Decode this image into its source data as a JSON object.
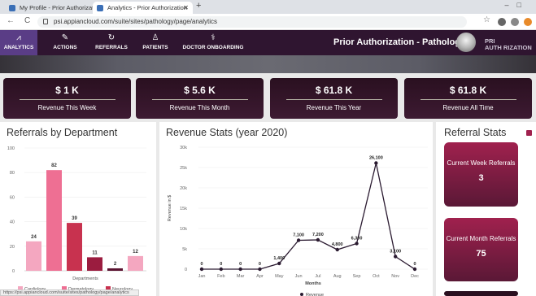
{
  "browser": {
    "tabs": [
      {
        "title": "My Profile - Prior Authorization"
      },
      {
        "title": "Analytics - Prior Authorization"
      }
    ],
    "url": "psi.appiancloud.com/suite/sites/pathology/page/analytics",
    "status_url": "https://psi.appiancloud.com/suite/sites/pathology/page/analytics"
  },
  "nav": {
    "items": [
      {
        "label": "ANALYTICS",
        "icon": "analytics-icon"
      },
      {
        "label": "ACTIONS",
        "icon": "actions-icon"
      },
      {
        "label": "REFERRALS",
        "icon": "referrals-icon"
      },
      {
        "label": "PATIENTS",
        "icon": "patients-icon"
      },
      {
        "label": "DOCTOR ONBOARDING",
        "icon": "doctor-icon"
      }
    ],
    "site_title": "Prior Authorization - Pathology",
    "logo_top": "PRI",
    "logo_bottom": "AUTH RIZATION"
  },
  "kpis": [
    {
      "value": "$ 1 K",
      "label": "Revenue This Week"
    },
    {
      "value": "$ 5.6 K",
      "label": "Revenue This Month"
    },
    {
      "value": "$ 61.8 K",
      "label": "Revenue This Year"
    },
    {
      "value": "$ 61.8 K",
      "label": "Revenue All Time"
    }
  ],
  "referrals": {
    "title": "Referrals by Department"
  },
  "revenue": {
    "title": "Revenue Stats (year 2020)"
  },
  "referral_stats": {
    "title": "Referral Stats",
    "cards": [
      {
        "label": "Current Week Referrals",
        "value": "3"
      },
      {
        "label": "Current Month Referrals",
        "value": "75"
      }
    ]
  },
  "chart_data": [
    {
      "type": "bar",
      "xlabel": "Departments",
      "ylim": [
        0,
        100
      ],
      "yticks": [
        0,
        20,
        40,
        60,
        80,
        100
      ],
      "values": [
        24,
        82,
        39,
        11,
        2,
        12
      ],
      "colors": [
        "#f4a7c0",
        "#ee6f93",
        "#c8324f",
        "#9b1c3f",
        "#5a1230",
        "#f4a7c0"
      ],
      "legend": [
        "Cardiology",
        "Dermatology",
        "Neurology"
      ],
      "legend_colors": [
        "#f4a7c0",
        "#ee6f93",
        "#c8324f"
      ]
    },
    {
      "type": "line",
      "xlabel": "Months",
      "ylabel": "Revenue in $",
      "ylim": [
        0,
        30000
      ],
      "yticks": [
        "0",
        "5k",
        "10k",
        "15k",
        "20k",
        "25k",
        "30k"
      ],
      "x": [
        "Jan",
        "Feb",
        "Mar",
        "Apr",
        "May",
        "Jun",
        "Jul",
        "Aug",
        "Sep",
        "Oct",
        "Nov",
        "Dec"
      ],
      "values": [
        0,
        0,
        0,
        0,
        1400,
        7100,
        7200,
        4800,
        6300,
        26100,
        3100,
        0
      ],
      "labels": [
        "0",
        "0",
        "0",
        "0",
        "1,400",
        "7,100",
        "7,200",
        "4,800",
        "6,300",
        "26,100",
        "3,100",
        "0"
      ],
      "legend": [
        "Revenue"
      ]
    }
  ]
}
